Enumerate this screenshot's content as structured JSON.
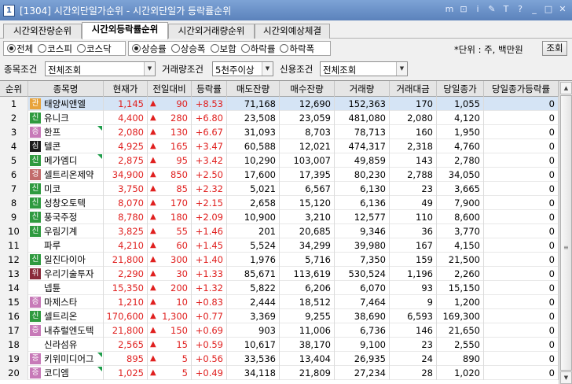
{
  "window": {
    "id_badge": "1",
    "title": "[1304] 시간외단일가순위 - 시간외단일가 등락률순위",
    "buttons": [
      "m",
      "⊡",
      "i",
      "✎",
      "T",
      "?",
      "_",
      "□",
      "✕"
    ]
  },
  "tabs": [
    {
      "label": "시간외잔량순위",
      "active": false
    },
    {
      "label": "시간외등락률순위",
      "active": true
    },
    {
      "label": "시간외거래량순위",
      "active": false
    },
    {
      "label": "시간외예상체결",
      "active": false
    }
  ],
  "market_filter": [
    {
      "label": "전체",
      "checked": true
    },
    {
      "label": "코스피",
      "checked": false
    },
    {
      "label": "코스닥",
      "checked": false
    }
  ],
  "sort_filter": [
    {
      "label": "상승률",
      "checked": true
    },
    {
      "label": "상승폭",
      "checked": false
    },
    {
      "label": "보합",
      "checked": false
    },
    {
      "label": "하락률",
      "checked": false
    },
    {
      "label": "하락폭",
      "checked": false
    }
  ],
  "unit_text": "*단위 : 주, 백만원",
  "lookup_button": "조회",
  "conditions": {
    "stock_label": "종목조건",
    "stock_value": "전체조회",
    "volume_label": "거래량조건",
    "volume_value": "5천주이상",
    "credit_label": "신용조건",
    "credit_value": "전체조회"
  },
  "columns": [
    "순위",
    "종목명",
    "현재가",
    "전일대비",
    "등락률",
    "매도잔량",
    "매수잔량",
    "거래량",
    "거래대금",
    "당일종가",
    "당일종가등락률"
  ],
  "badge_colors": {
    "관": "#e8a33b",
    "신": "#2f9a3f",
    "증": "#c77ab8",
    "위": "#8a2a3a",
    "심": "#1a1a1a",
    "경": "#c26b6b"
  },
  "rows": [
    {
      "rank": "1",
      "badge": "관",
      "name": "태양씨앤엘",
      "flag": false,
      "price": "1,145",
      "change": "90",
      "rate": "+8.53",
      "ask_qty": "71,168",
      "bid_qty": "12,690",
      "volume": "152,363",
      "amount": "170",
      "close": "1,055",
      "close_rate": "0"
    },
    {
      "rank": "2",
      "badge": "신",
      "name": "유니크",
      "flag": false,
      "price": "4,400",
      "change": "280",
      "rate": "+6.80",
      "ask_qty": "23,508",
      "bid_qty": "23,059",
      "volume": "481,080",
      "amount": "2,080",
      "close": "4,120",
      "close_rate": "0"
    },
    {
      "rank": "3",
      "badge": "증",
      "name": "한프",
      "flag": true,
      "price": "2,080",
      "change": "130",
      "rate": "+6.67",
      "ask_qty": "31,093",
      "bid_qty": "8,703",
      "volume": "78,713",
      "amount": "160",
      "close": "1,950",
      "close_rate": "0"
    },
    {
      "rank": "4",
      "badge": "심",
      "name": "텔콘",
      "flag": false,
      "price": "4,925",
      "change": "165",
      "rate": "+3.47",
      "ask_qty": "60,588",
      "bid_qty": "12,021",
      "volume": "474,317",
      "amount": "2,318",
      "close": "4,760",
      "close_rate": "0"
    },
    {
      "rank": "5",
      "badge": "신",
      "name": "메가엠디",
      "flag": true,
      "price": "2,875",
      "change": "95",
      "rate": "+3.42",
      "ask_qty": "10,290",
      "bid_qty": "103,007",
      "volume": "49,859",
      "amount": "143",
      "close": "2,780",
      "close_rate": "0"
    },
    {
      "rank": "6",
      "badge": "경",
      "name": "셀트리온제약",
      "flag": false,
      "price": "34,900",
      "change": "850",
      "rate": "+2.50",
      "ask_qty": "17,600",
      "bid_qty": "17,395",
      "volume": "80,230",
      "amount": "2,788",
      "close": "34,050",
      "close_rate": "0"
    },
    {
      "rank": "7",
      "badge": "신",
      "name": "미코",
      "flag": false,
      "price": "3,750",
      "change": "85",
      "rate": "+2.32",
      "ask_qty": "5,021",
      "bid_qty": "6,567",
      "volume": "6,130",
      "amount": "23",
      "close": "3,665",
      "close_rate": "0"
    },
    {
      "rank": "8",
      "badge": "신",
      "name": "성창오토텍",
      "flag": false,
      "price": "8,070",
      "change": "170",
      "rate": "+2.15",
      "ask_qty": "2,658",
      "bid_qty": "15,120",
      "volume": "6,136",
      "amount": "49",
      "close": "7,900",
      "close_rate": "0"
    },
    {
      "rank": "9",
      "badge": "신",
      "name": "풍국주정",
      "flag": false,
      "price": "8,780",
      "change": "180",
      "rate": "+2.09",
      "ask_qty": "10,900",
      "bid_qty": "3,210",
      "volume": "12,577",
      "amount": "110",
      "close": "8,600",
      "close_rate": "0"
    },
    {
      "rank": "10",
      "badge": "신",
      "name": "우림기계",
      "flag": false,
      "price": "3,825",
      "change": "55",
      "rate": "+1.46",
      "ask_qty": "201",
      "bid_qty": "20,685",
      "volume": "9,346",
      "amount": "36",
      "close": "3,770",
      "close_rate": "0"
    },
    {
      "rank": "11",
      "badge": "",
      "name": "파루",
      "flag": false,
      "price": "4,210",
      "change": "60",
      "rate": "+1.45",
      "ask_qty": "5,524",
      "bid_qty": "34,299",
      "volume": "39,980",
      "amount": "167",
      "close": "4,150",
      "close_rate": "0"
    },
    {
      "rank": "12",
      "badge": "신",
      "name": "일진다이아",
      "flag": false,
      "price": "21,800",
      "change": "300",
      "rate": "+1.40",
      "ask_qty": "1,976",
      "bid_qty": "5,716",
      "volume": "7,350",
      "amount": "159",
      "close": "21,500",
      "close_rate": "0"
    },
    {
      "rank": "13",
      "badge": "위",
      "name": "우리기술투자",
      "flag": false,
      "price": "2,290",
      "change": "30",
      "rate": "+1.33",
      "ask_qty": "85,671",
      "bid_qty": "113,619",
      "volume": "530,524",
      "amount": "1,196",
      "close": "2,260",
      "close_rate": "0"
    },
    {
      "rank": "14",
      "badge": "",
      "name": "넵튠",
      "flag": false,
      "price": "15,350",
      "change": "200",
      "rate": "+1.32",
      "ask_qty": "5,822",
      "bid_qty": "6,206",
      "volume": "6,070",
      "amount": "93",
      "close": "15,150",
      "close_rate": "0"
    },
    {
      "rank": "15",
      "badge": "증",
      "name": "마제스타",
      "flag": false,
      "price": "1,210",
      "change": "10",
      "rate": "+0.83",
      "ask_qty": "2,444",
      "bid_qty": "18,512",
      "volume": "7,464",
      "amount": "9",
      "close": "1,200",
      "close_rate": "0"
    },
    {
      "rank": "16",
      "badge": "신",
      "name": "셀트리온",
      "flag": false,
      "price": "170,600",
      "change": "1,300",
      "rate": "+0.77",
      "ask_qty": "3,369",
      "bid_qty": "9,255",
      "volume": "38,690",
      "amount": "6,593",
      "close": "169,300",
      "close_rate": "0"
    },
    {
      "rank": "17",
      "badge": "증",
      "name": "내츄럴엔도텍",
      "flag": false,
      "price": "21,800",
      "change": "150",
      "rate": "+0.69",
      "ask_qty": "903",
      "bid_qty": "11,006",
      "volume": "6,736",
      "amount": "146",
      "close": "21,650",
      "close_rate": "0"
    },
    {
      "rank": "18",
      "badge": "",
      "name": "신라섬유",
      "flag": false,
      "price": "2,565",
      "change": "15",
      "rate": "+0.59",
      "ask_qty": "10,617",
      "bid_qty": "38,170",
      "volume": "9,100",
      "amount": "23",
      "close": "2,550",
      "close_rate": "0"
    },
    {
      "rank": "19",
      "badge": "증",
      "name": "키위미디어그",
      "flag": true,
      "price": "895",
      "change": "5",
      "rate": "+0.56",
      "ask_qty": "33,536",
      "bid_qty": "13,404",
      "volume": "26,935",
      "amount": "24",
      "close": "890",
      "close_rate": "0"
    },
    {
      "rank": "20",
      "badge": "증",
      "name": "코디엠",
      "flag": true,
      "price": "1,025",
      "change": "5",
      "rate": "+0.49",
      "ask_qty": "34,118",
      "bid_qty": "21,809",
      "volume": "27,234",
      "amount": "28",
      "close": "1,020",
      "close_rate": "0"
    }
  ]
}
